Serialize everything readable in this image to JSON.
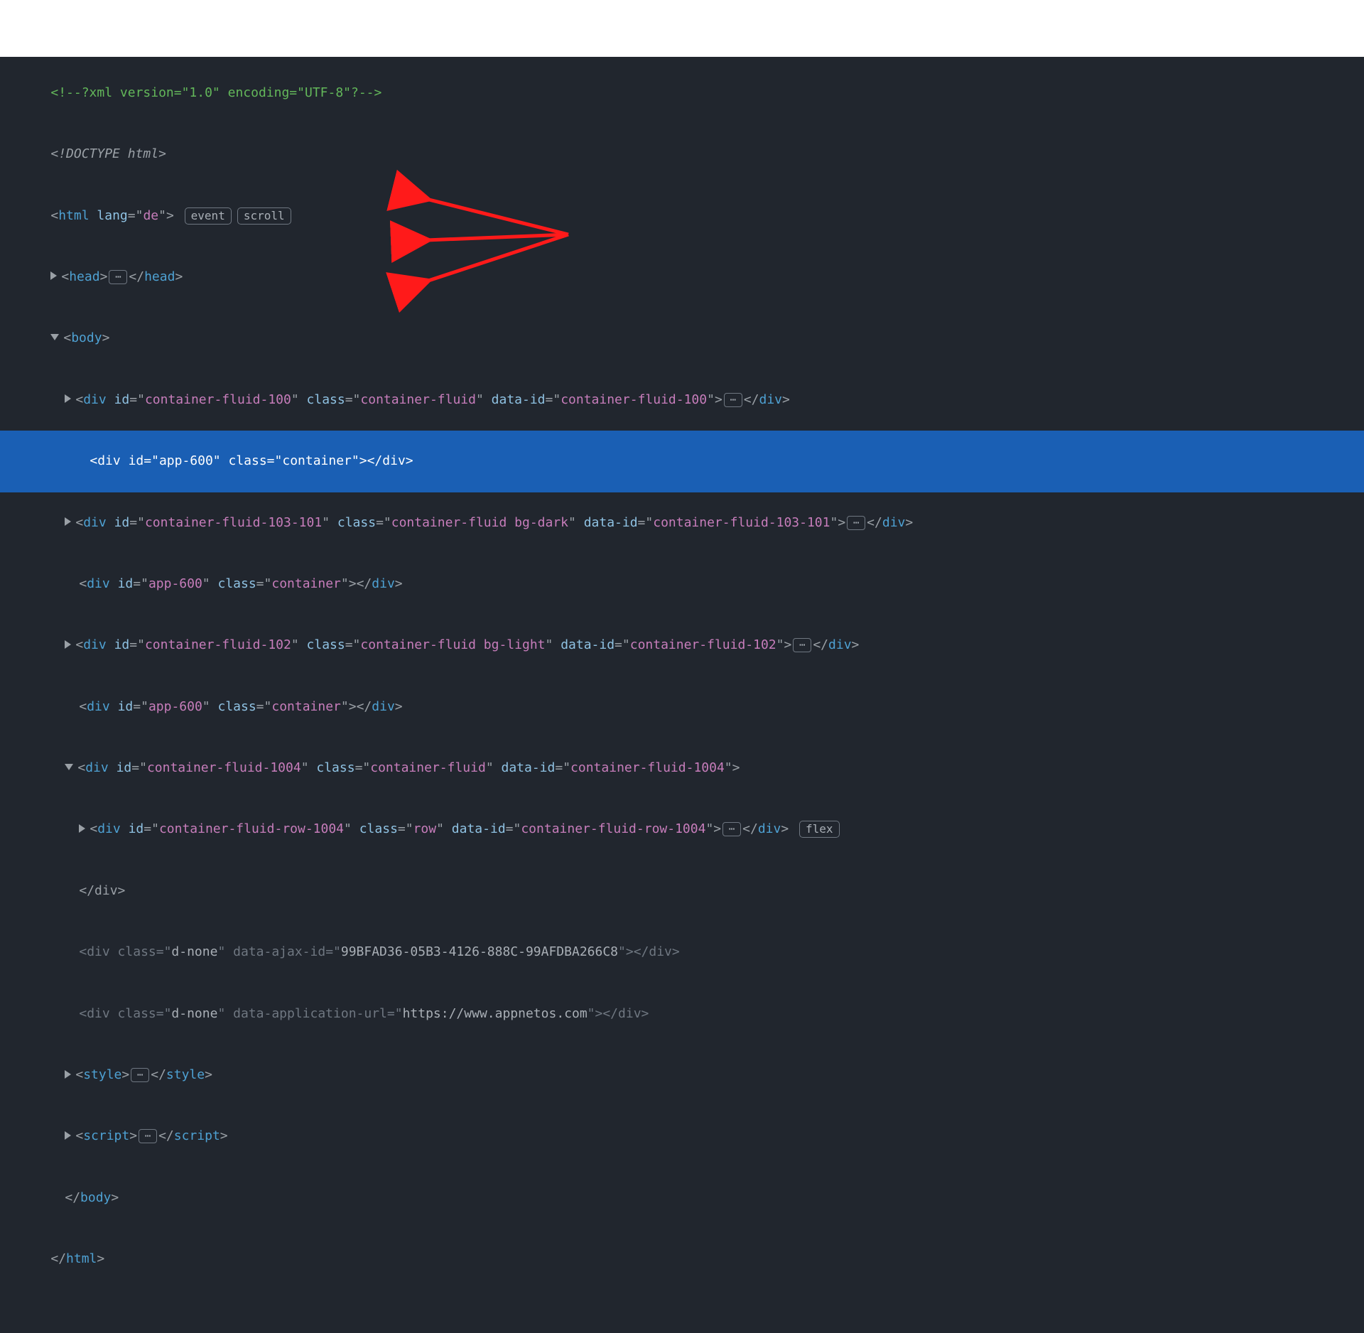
{
  "badges": {
    "event": "event",
    "scroll": "scroll",
    "flex": "flex",
    "ellipsis": "⋯"
  },
  "lines": {
    "l1": "<!--?xml version=\"1.0\" encoding=\"UTF-8\"?-->",
    "l3": {
      "tag": "html",
      "attr": "lang",
      "val": "de"
    },
    "l5": {
      "tag": "body"
    },
    "cf100": {
      "tag": "div",
      "id": "container-fluid-100",
      "class": "container-fluid",
      "dataid": "container-fluid-100"
    },
    "app600": {
      "tag": "div",
      "id": "app-600",
      "class": "container"
    },
    "cf103": {
      "tag": "div",
      "id": "container-fluid-103-101",
      "class": "container-fluid bg-dark",
      "dataid": "container-fluid-103-101"
    },
    "cf102": {
      "tag": "div",
      "id": "container-fluid-102",
      "class": "container-fluid bg-light",
      "dataid": "container-fluid-102"
    },
    "cf1004": {
      "tag": "div",
      "id": "container-fluid-1004",
      "class": "container-fluid",
      "dataid": "container-fluid-1004"
    },
    "cfrow1004": {
      "tag": "div",
      "id": "container-fluid-row-1004",
      "class": "row",
      "dataid": "container-fluid-row-1004"
    },
    "dnone1": {
      "tag": "div",
      "class": "d-none",
      "attr": "data-ajax-id",
      "val": "99BFAD36-05B3-4126-888C-99AFDBA266C8"
    },
    "dnone2": {
      "tag": "div",
      "class": "d-none",
      "attr": "data-application-url",
      "val": "https://www.appnetos.com"
    },
    "styleTag": "style",
    "scriptTag": "script",
    "doctype": "<!DOCTYPE html>",
    "headTag": "head",
    "closeDiv": "</div>",
    "closeBody": "</body>",
    "closeHtml": "</html>"
  }
}
